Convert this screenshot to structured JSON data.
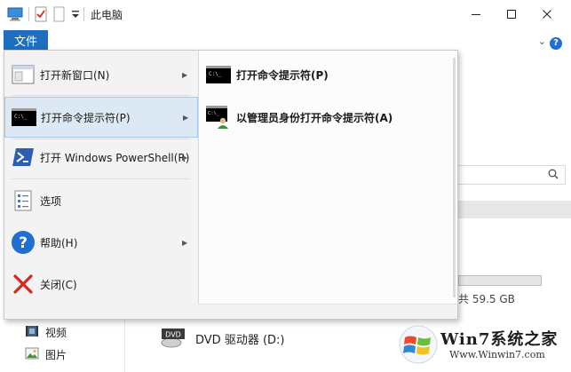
{
  "window": {
    "title": "此电脑",
    "controls": [
      "minimize",
      "maximize",
      "close"
    ]
  },
  "quick_access": {
    "icons": [
      "computer-icon",
      "properties-check-icon",
      "new-folder-icon",
      "dropdown-arrow-icon"
    ]
  },
  "file_tab": {
    "label": "文件"
  },
  "file_menu": {
    "items": [
      {
        "label": "打开新窗口(N)",
        "icon": "new-window-icon",
        "has_submenu": true
      },
      {
        "label": "打开命令提示符(P)",
        "icon": "cmd-icon",
        "has_submenu": true,
        "highlighted": true
      },
      {
        "label": "打开 Windows PowerShell(R)",
        "icon": "powershell-icon",
        "has_submenu": true
      },
      {
        "label": "选项",
        "icon": "options-icon",
        "has_submenu": false
      },
      {
        "label": "帮助(H)",
        "icon": "help-icon",
        "has_submenu": true
      },
      {
        "label": "关闭(C)",
        "icon": "close-x-icon",
        "has_submenu": false
      }
    ],
    "submenu": [
      {
        "label": "打开命令提示符(P)",
        "icon": "cmd-icon"
      },
      {
        "label": "以管理员身份打开命令提示符(A)",
        "icon": "cmd-admin-icon"
      }
    ]
  },
  "background": {
    "disk_usage_text": "共 59.5 GB",
    "nav_items": [
      {
        "label": "视频",
        "icon": "videos-icon"
      },
      {
        "label": "图片",
        "icon": "pictures-icon"
      }
    ],
    "dvd_drive": {
      "label": "DVD 驱动器 (D:)",
      "icon_text": "DVD",
      "icon": "dvd-drive-icon"
    }
  },
  "watermark": {
    "title": "Win7系统之家",
    "url": "Www.Winwin7.com",
    "icon": "windows-logo-icon"
  },
  "colors": {
    "file_tab_blue": "#1e6fbf",
    "menu_bg": "#f3f3f3",
    "highlight_bg": "#dce9f5",
    "close_red": "#d9261c",
    "powershell_blue": "#2b5fb4"
  }
}
